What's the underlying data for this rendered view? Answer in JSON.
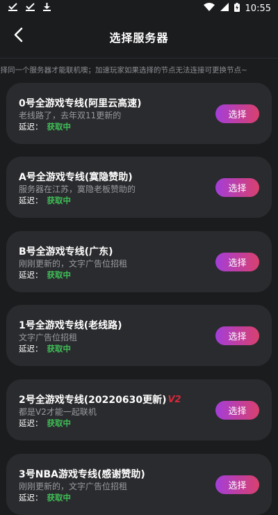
{
  "status_bar": {
    "time": "10:55",
    "left_icons": [
      "download-done-icon",
      "download-done-icon",
      "download-icon"
    ],
    "right_icons": [
      "wifi-icon",
      "signal-icon",
      "battery-charging-icon"
    ]
  },
  "header": {
    "title": "选择服务器",
    "back_icon": "chevron-left-icon"
  },
  "notice": "选择同一个服务器才能联机噢；加速玩家如果选择的节点无法连接可更换节点~",
  "labels": {
    "latency": "延迟：",
    "select": "选择"
  },
  "servers": [
    {
      "name": "0号全游戏专线(阿里云高速)",
      "desc": "老线路了，去年双11更新的",
      "status": "获取中",
      "badge": ""
    },
    {
      "name": "A号全游戏专线(寞隐赞助)",
      "desc": "服务器在江苏，寞隐老板赞助的",
      "status": "获取中",
      "badge": ""
    },
    {
      "name": "B号全游戏专线(广东)",
      "desc": "刚刚更新的，文字广告位招租",
      "status": "获取中",
      "badge": ""
    },
    {
      "name": "1号全游戏专线(老线路)",
      "desc": "文字广告位招租",
      "status": "获取中",
      "badge": ""
    },
    {
      "name": "2号全游戏专线(20220630更新)",
      "desc": "都是V2才能一起联机",
      "status": "获取中",
      "badge": "V2"
    },
    {
      "name": "3号NBA游戏专线(感谢赞助)",
      "desc": "刚刚更新的，文字广告位招租",
      "status": "获取中",
      "badge": ""
    }
  ],
  "colors": {
    "background": "#1b1c1e",
    "card": "#2a2b2e",
    "status_green": "#3fbf57",
    "button_gradient_start": "#a43ed8",
    "button_gradient_end": "#d8406e"
  }
}
